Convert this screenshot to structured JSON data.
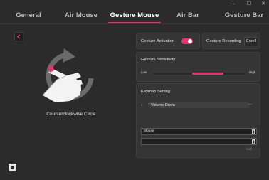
{
  "window_controls": {
    "minimize": "—",
    "maximize": "☐",
    "close": "✕"
  },
  "tabs": [
    {
      "label": "General"
    },
    {
      "label": "Air Mouse"
    },
    {
      "label": "Gesture Mouse"
    },
    {
      "label": "Air Bar"
    },
    {
      "label": "Gesture Bar"
    }
  ],
  "active_tab": "Gesture Mouse",
  "gesture": {
    "name": "Counterclockwise Circle"
  },
  "gesture_activation": {
    "label": "Gesture Activation",
    "enabled": true
  },
  "gesture_recording": {
    "label": "Gesture Recording",
    "button": "Enroll"
  },
  "sensitivity": {
    "title": "Gesture Sensitivity",
    "low_label": "Low",
    "high_label": "High",
    "range_start": 0.43,
    "range_end": 0.77
  },
  "keymap": {
    "title": "Keymap Setting",
    "rows": [
      {
        "index": "1",
        "value": "Volume Down",
        "remove": "—"
      }
    ],
    "device_select": "Mouse",
    "action_select": "",
    "add_label": "Add"
  },
  "colors": {
    "accent": "#e8336d",
    "background": "#2b2b2b",
    "card": "#353535"
  }
}
